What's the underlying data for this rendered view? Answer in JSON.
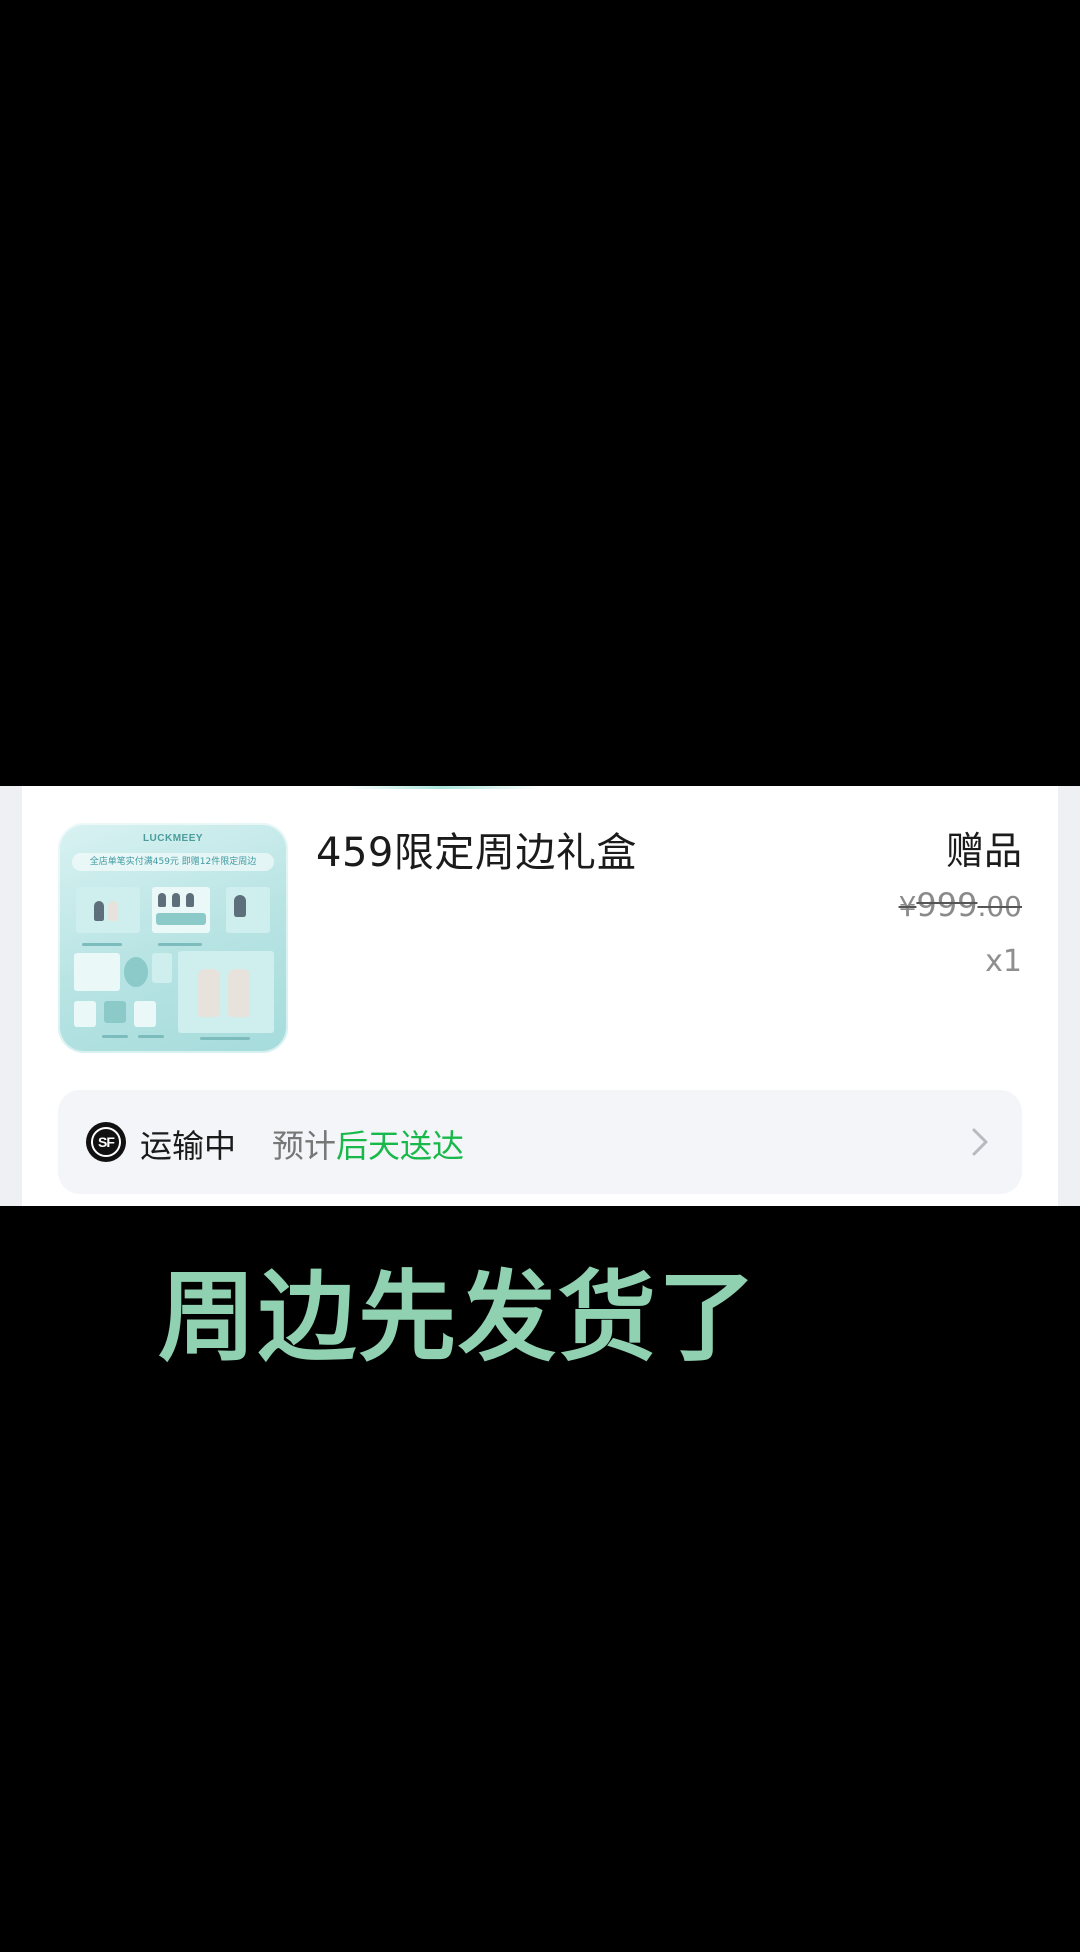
{
  "product": {
    "thumbnail_brand": "LUCKMEEY",
    "thumbnail_promo": "全店单笔实付满459元 即赠12件限定周边",
    "title": "459限定周边礼盒",
    "gift_label": "赠品",
    "original_price_symbol": "¥",
    "original_price_integer": "999",
    "original_price_decimal": ".00",
    "quantity": "x1"
  },
  "shipping": {
    "carrier_icon": "sf-express-icon",
    "carrier_mark": "SF",
    "status": "运输中",
    "eta_prefix": "预计",
    "eta_value": "后天送达"
  },
  "caption": {
    "text": "周边先发货了"
  },
  "colors": {
    "eta_green": "#18b94a",
    "caption_green": "#8fd1b0",
    "background": "#000000",
    "card": "#ffffff",
    "shipping_strip": "#f4f5f9"
  }
}
